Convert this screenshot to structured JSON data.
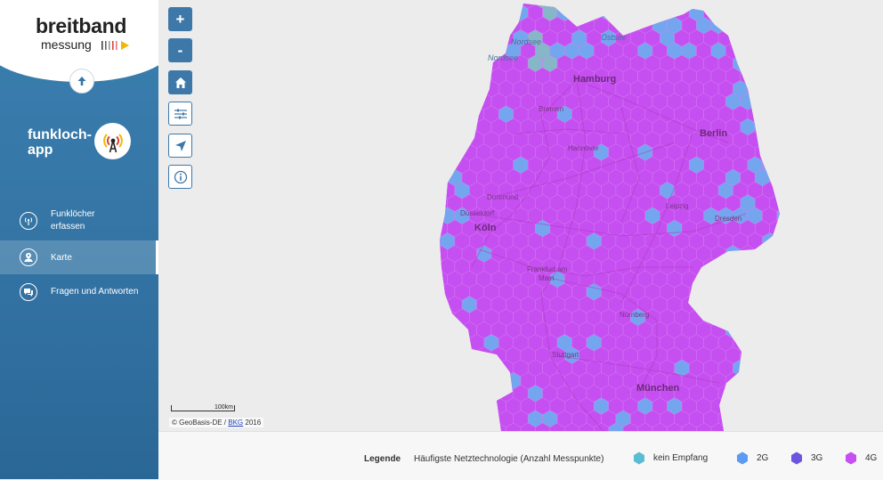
{
  "brand": {
    "name": "breitband",
    "sub": "messung"
  },
  "app": {
    "title_line1": "funkloch-",
    "title_line2": "app"
  },
  "nav": [
    {
      "line1": "Funklöcher",
      "line2": "erfassen"
    },
    {
      "line1": "Karte"
    },
    {
      "line1": "Fragen und Antworten"
    }
  ],
  "map": {
    "zoom_in": "+",
    "zoom_out": "-",
    "scale": "100km",
    "attribution_prefix": "© GeoBasis-DE / ",
    "attribution_link": "BKG",
    "attribution_suffix": " 2016",
    "cities": {
      "hamburg": "Hamburg",
      "bremen": "Bremen",
      "hannover": "Hannover",
      "berlin": "Berlin",
      "dortmund": "Dortmund",
      "duesseldorf": "Düsseldorf",
      "koeln": "Köln",
      "leipzig": "Leipzig",
      "dresden": "Dresden",
      "frankfurt1": "Frankfurt am",
      "frankfurt2": "Main",
      "nuernberg": "Nürnberg",
      "stuttgart": "Stuttgart",
      "muenchen": "München",
      "nordsee1": "Nordsee",
      "nordsee2": "Nordsee",
      "ostsee": "Ostsee"
    }
  },
  "legend": {
    "title": "Legende",
    "subtitle": "Häufigste Netztechnologie (Anzahl Messpunkte)",
    "items": [
      {
        "label": "kein Empfang",
        "color": "#5bbdd3"
      },
      {
        "label": "2G",
        "color": "#5b9cf2"
      },
      {
        "label": "3G",
        "color": "#6b55e0"
      },
      {
        "label": "4G",
        "color": "#c54ff0"
      }
    ]
  },
  "colors": {
    "sidebar": "#3576a6",
    "accent": "#3d78a9",
    "hex_4g": "#c54ff0",
    "hex_2g": "#74a6ef",
    "hex_none": "#86b7c8"
  }
}
